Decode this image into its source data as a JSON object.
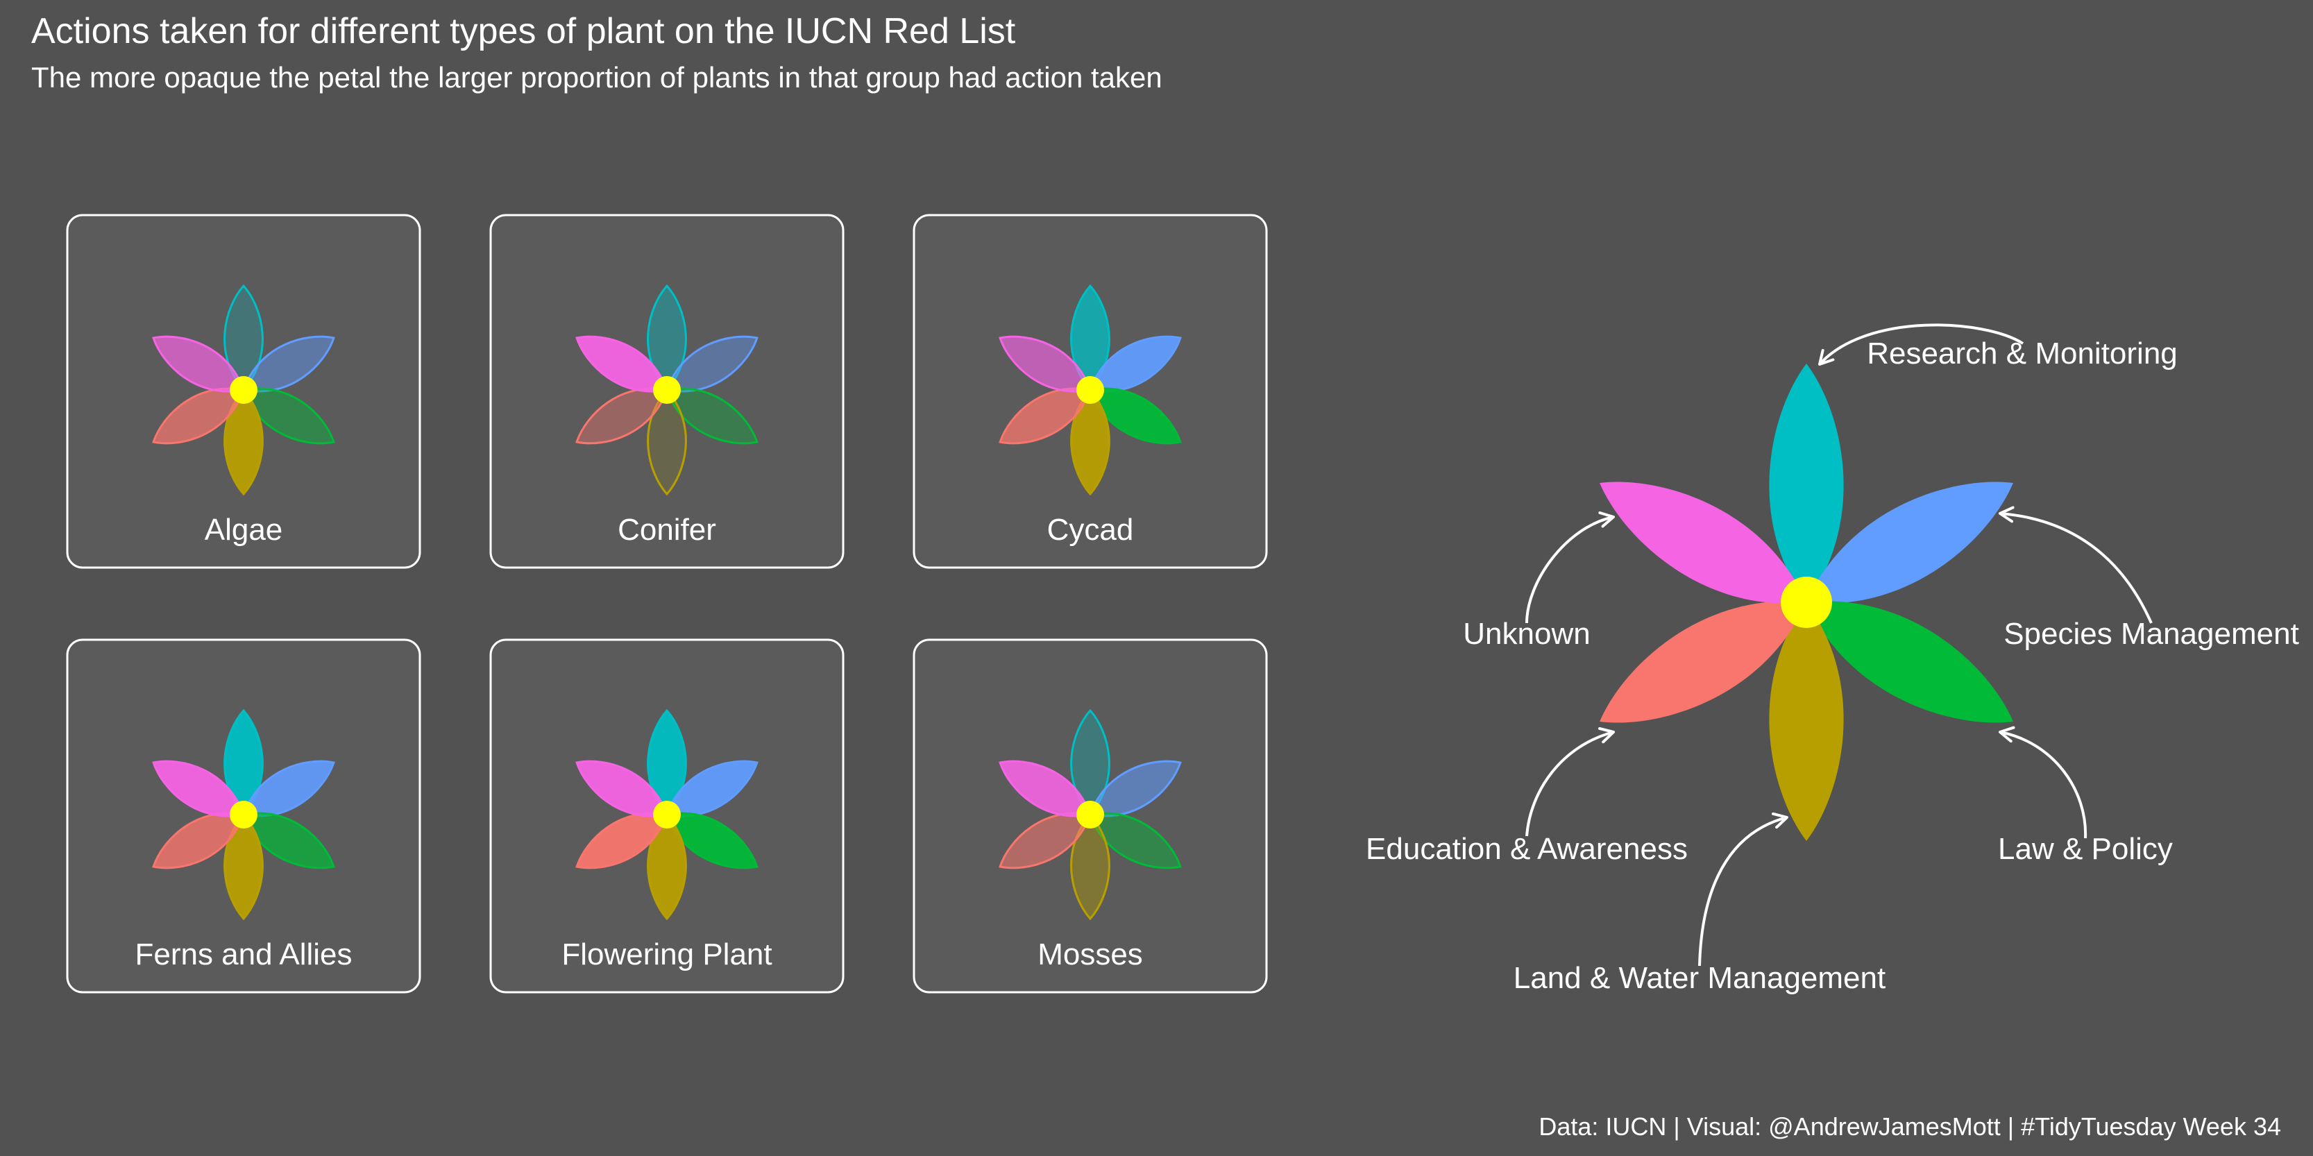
{
  "title": "Actions taken for different types of plant on the IUCN Red List",
  "subtitle": "The more opaque the petal the larger proportion of plants in that group had action taken",
  "caption": "Data: IUCN | Visual: @AndrewJamesMott | #TidyTuesday Week 34",
  "colors": {
    "background": "#525252",
    "panel_fill": "#5b5b5b",
    "panel_border": "#ffffff",
    "center": "#ffff00",
    "text": "#ffffff"
  },
  "chart_data": {
    "type": "small-multiple flower (radial petal) chart",
    "encoding": "petal opacity = proportion of plants in group with action taken",
    "actions": [
      {
        "name": "Research & Monitoring",
        "color": "#00bfc4",
        "angle_deg": 0
      },
      {
        "name": "Species Management",
        "color": "#619cff",
        "angle_deg": 60
      },
      {
        "name": "Law & Policy",
        "color": "#00ba38",
        "angle_deg": 120
      },
      {
        "name": "Land & Water Management",
        "color": "#b79f00",
        "angle_deg": 180
      },
      {
        "name": "Education & Awareness",
        "color": "#f8766d",
        "angle_deg": 240
      },
      {
        "name": "Unknown",
        "color": "#f564e3",
        "angle_deg": 300
      }
    ],
    "groups": [
      {
        "name": "Algae",
        "opacity": [
          0.25,
          0.45,
          0.45,
          0.95,
          0.7,
          0.7
        ]
      },
      {
        "name": "Conifer",
        "opacity": [
          0.4,
          0.4,
          0.35,
          0.15,
          0.4,
          0.95
        ]
      },
      {
        "name": "Cycad",
        "opacity": [
          0.75,
          0.95,
          0.95,
          0.95,
          0.75,
          0.65
        ]
      },
      {
        "name": "Ferns and Allies",
        "opacity": [
          0.95,
          0.9,
          0.7,
          0.95,
          0.8,
          0.95
        ]
      },
      {
        "name": "Flowering Plant",
        "opacity": [
          0.95,
          0.95,
          0.95,
          0.95,
          0.95,
          0.95
        ]
      },
      {
        "name": "Mosses",
        "opacity": [
          0.3,
          0.55,
          0.45,
          0.4,
          0.55,
          0.9
        ]
      }
    ],
    "legend": {
      "type": "annotated key flower",
      "opacity": 1.0
    }
  }
}
